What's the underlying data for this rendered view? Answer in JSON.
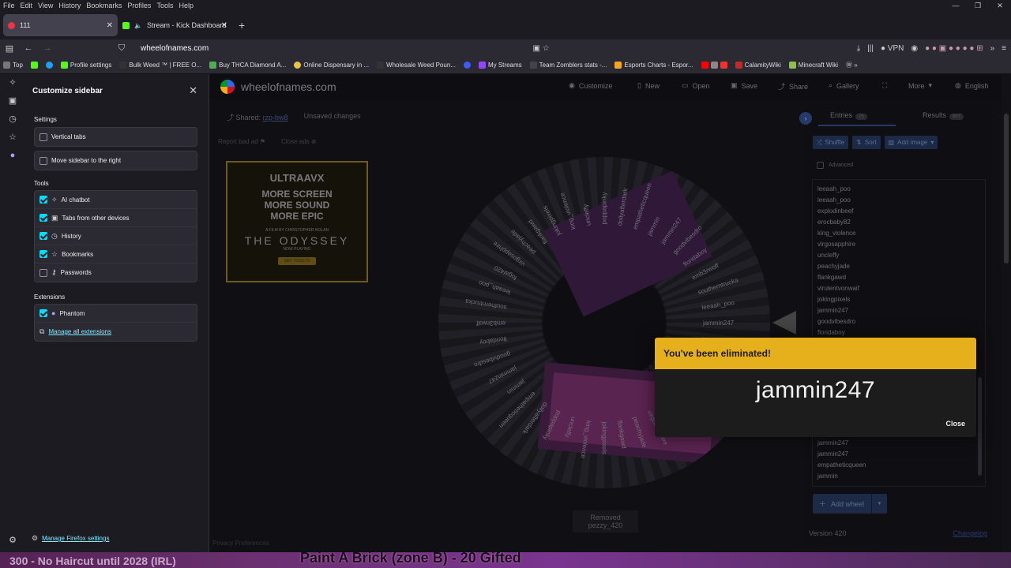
{
  "menubar": {
    "items": [
      "File",
      "Edit",
      "View",
      "History",
      "Bookmarks",
      "Profiles",
      "Tools",
      "Help"
    ]
  },
  "tabs": [
    {
      "label": "111",
      "close": "✕"
    },
    {
      "label": "Stream - Kick Dashboard",
      "close": "✕"
    }
  ],
  "newtab": "+",
  "url": "wheelofnames.com",
  "vpn": "VPN",
  "bookmarks": [
    {
      "label": "Top",
      "color": "#777"
    },
    {
      "label": "",
      "color": "#53fc18"
    },
    {
      "label": "",
      "color": "#1da1f2"
    },
    {
      "label": "Profile settings",
      "color": "#53fc18"
    },
    {
      "label": "Bulk Weed ™ | FREE O...",
      "color": "#333"
    },
    {
      "label": "Buy THCA Diamond A...",
      "color": "#4caf50"
    },
    {
      "label": "Online Dispensary in ...",
      "color": "#e8c34a"
    },
    {
      "label": "Wholesale Weed Poun...",
      "color": "#333"
    },
    {
      "label": "",
      "color": "#3d5afe"
    },
    {
      "label": "My Streams",
      "color": "#9146ff"
    },
    {
      "label": "Team Zomblers stats -...",
      "color": "#444"
    },
    {
      "label": "Esports Charts - Espor...",
      "color": "#f5a623"
    },
    {
      "label": "",
      "color": "#ff0000"
    },
    {
      "label": "CalamityWiki",
      "color": "#c62828"
    },
    {
      "label": "Minecraft Wiki",
      "color": "#8bc34a"
    }
  ],
  "sidebar": {
    "title": "Customize sidebar",
    "close": "✕",
    "settings_heading": "Settings",
    "settings": [
      {
        "label": "Vertical tabs",
        "checked": false
      },
      {
        "label": "Move sidebar to the right",
        "checked": false
      }
    ],
    "tools_heading": "Tools",
    "tools": [
      {
        "label": "AI chatbot",
        "checked": true
      },
      {
        "label": "Tabs from other devices",
        "checked": true
      },
      {
        "label": "History",
        "checked": true
      },
      {
        "label": "Bookmarks",
        "checked": true
      },
      {
        "label": "Passwords",
        "checked": false
      }
    ],
    "extensions_heading": "Extensions",
    "extensions": [
      {
        "label": "Phantom",
        "checked": true
      }
    ],
    "manage_extensions": "Manage all extensions",
    "manage_firefox": "Manage Firefox settings"
  },
  "site": {
    "logo": "wheelofnames.com",
    "nav": [
      "Customize",
      "New",
      "Open",
      "Save",
      "Share",
      "Gallery",
      "More",
      "English"
    ],
    "shared_label": "Shared:",
    "shared_code": "rzp-bw8",
    "unsaved": "Unsaved changes",
    "report_ad": "Report bad ad",
    "close_ads": "Close ads",
    "privacy": "Privacy Preferences",
    "toast": "Removed pezzy_420"
  },
  "ad": {
    "brand": "ULTRAAVX",
    "line1": "MORE SCREEN",
    "line2": "MORE SOUND",
    "line3": "MORE EPIC",
    "credit": "A FILM BY CHRISTOPHER NOLAN",
    "movie": "THE ODYSSEY",
    "now_playing": "NOW PLAYING",
    "ticket": "GET TICKETS"
  },
  "wheel_labels": [
    "jammin247",
    "goodvibesdro",
    "floridaboy",
    "emb3rwolf",
    "southerntrucka",
    "leeaah_poo",
    "fogal420",
    "virgosapphire",
    "peachyjade",
    "flankgawd",
    "jokingpixels",
    "king_violence",
    "uncleffy",
    "poppapinky",
    "dollyafterdark",
    "empatheticqueen",
    "jammin"
  ],
  "modal": {
    "title": "You've been eliminated!",
    "name": "jammin247",
    "close": "Close",
    "header_color": "#e5b01c"
  },
  "right_panel": {
    "tab_entries": "Entries",
    "entries_count": "75",
    "tab_results": "Results",
    "results_count": "507",
    "shuffle": "Shuffle",
    "sort": "Sort",
    "add_image": "Add image",
    "advanced": "Advanced",
    "entries": [
      "leeaah_poo",
      "leeaah_poo",
      "explodinbeef",
      "erocbaby82",
      "king_violence",
      "virgosapphire",
      "uncleffy",
      "peachyjade",
      "flankgawd",
      "virulentvonwaif",
      "jokingpixels",
      "jammin247",
      "goodvibesdro",
      "floridaboy",
      "emb3rwolf",
      "jammin247",
      "southerntrucka",
      "greencodes632",
      "leeaah_poo",
      "poppapinky",
      "leeaah_poo",
      "dollyafterdark",
      "fogal420",
      "jammin247",
      "jammin247",
      "empatheticqueen",
      "jammin"
    ],
    "add_wheel": "Add wheel",
    "version": "Version 420",
    "changelog": "Changelog"
  },
  "banner": {
    "left": "300 - No Haircut until 2028 (IRL)",
    "center": "Paint A Brick (zone B) - 20 Gifted"
  }
}
